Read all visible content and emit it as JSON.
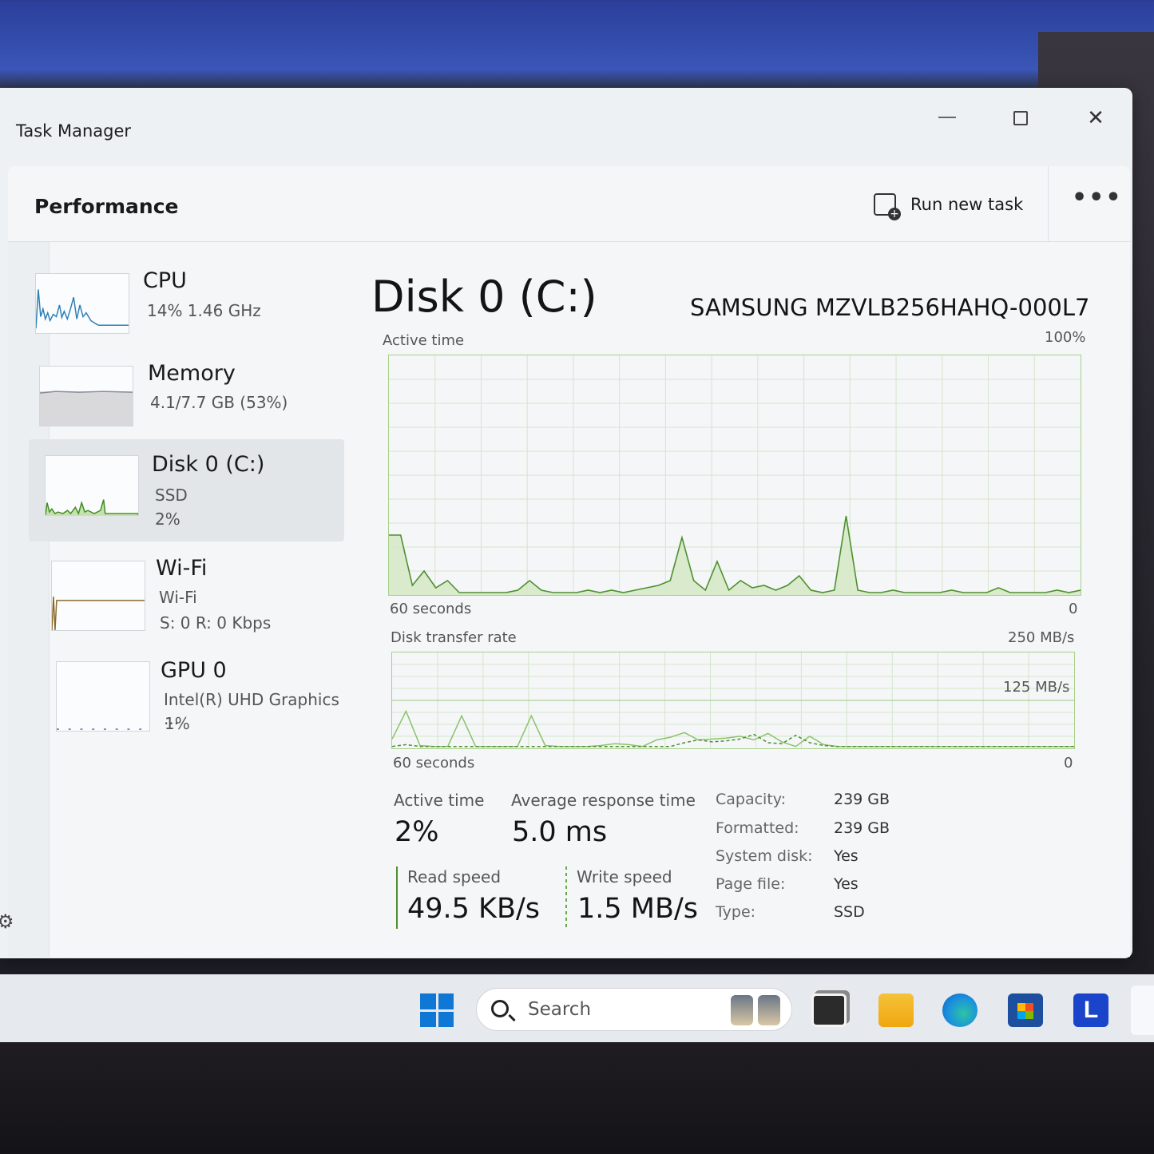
{
  "window": {
    "title": "Task Manager"
  },
  "header": {
    "page_title": "Performance",
    "run_new_task": "Run new task",
    "more_label": "•••"
  },
  "sidebar": {
    "items": [
      {
        "name": "CPU",
        "line1": "14%  1.46 GHz",
        "line2": ""
      },
      {
        "name": "Memory",
        "line1": "4.1/7.7 GB (53%)",
        "line2": ""
      },
      {
        "name": "Disk 0 (C:)",
        "line1": "SSD",
        "line2": "2%"
      },
      {
        "name": "Wi-Fi",
        "line1": "Wi-Fi",
        "line2": "S: 0  R: 0 Kbps"
      },
      {
        "name": "GPU 0",
        "line1": "Intel(R) UHD Graphics ...",
        "line2": "1%"
      }
    ],
    "selected": "Disk 0 (C:)"
  },
  "main": {
    "title": "Disk 0 (C:)",
    "model": "SAMSUNG MZVLB256HAHQ-000L7",
    "active_chart": {
      "label": "Active time",
      "max_label": "100%",
      "time_label": "60 seconds",
      "min_label": "0"
    },
    "transfer_chart": {
      "label": "Disk transfer rate",
      "max_label": "250 MB/s",
      "mid_label": "125 MB/s",
      "time_label": "60 seconds",
      "min_label": "0"
    },
    "stats": {
      "active_time_label": "Active time",
      "active_time": "2%",
      "avg_resp_label": "Average response time",
      "avg_resp": "5.0 ms",
      "read_label": "Read speed",
      "read": "49.5 KB/s",
      "write_label": "Write speed",
      "write": "1.5 MB/s"
    },
    "properties": [
      {
        "key": "Capacity:",
        "value": "239 GB"
      },
      {
        "key": "Formatted:",
        "value": "239 GB"
      },
      {
        "key": "System disk:",
        "value": "Yes"
      },
      {
        "key": "Page file:",
        "value": "Yes"
      },
      {
        "key": "Type:",
        "value": "SSD"
      }
    ]
  },
  "taskbar": {
    "search_placeholder": "Search",
    "l_app_letter": "L"
  },
  "chart_data": [
    {
      "type": "area",
      "title": "Active time",
      "ylim": [
        0,
        100
      ],
      "y_unit": "%",
      "x_span_seconds": 60,
      "values": [
        25,
        25,
        4,
        10,
        3,
        6,
        1,
        1,
        1,
        1,
        1,
        2,
        6,
        2,
        1,
        1,
        1,
        2,
        1,
        2,
        1,
        2,
        3,
        4,
        6,
        24,
        6,
        2,
        14,
        2,
        6,
        3,
        4,
        2,
        4,
        8,
        2,
        1,
        2,
        33,
        2,
        1,
        1,
        2,
        1,
        1,
        1,
        1,
        2,
        1,
        1,
        1,
        3,
        1,
        1,
        1,
        1,
        2,
        1,
        2
      ]
    },
    {
      "type": "line",
      "title": "Disk transfer rate",
      "ylim": [
        0,
        250
      ],
      "y_unit": "MB/s",
      "x_span_seconds": 60,
      "series": [
        {
          "values": [
            20,
            80,
            6,
            4,
            4,
            70,
            4,
            4,
            4,
            4,
            70,
            6,
            4,
            4,
            4,
            6,
            10,
            8,
            4,
            18,
            24,
            34,
            18,
            20,
            22,
            26,
            18,
            32,
            14,
            4,
            26,
            8,
            4,
            4,
            4,
            4,
            4,
            4,
            4,
            4,
            4,
            4,
            4,
            4,
            4,
            4,
            4,
            4,
            4,
            4
          ]
        },
        {
          "values": [
            4,
            8,
            4,
            4,
            4,
            4,
            4,
            4,
            4,
            4,
            4,
            4,
            4,
            4,
            4,
            4,
            4,
            4,
            4,
            4,
            4,
            12,
            18,
            14,
            16,
            20,
            30,
            12,
            10,
            28,
            12,
            6,
            4,
            4,
            4,
            4,
            4,
            4,
            4,
            4,
            4,
            4,
            4,
            4,
            4,
            4,
            4,
            4,
            4,
            4
          ]
        }
      ]
    }
  ]
}
